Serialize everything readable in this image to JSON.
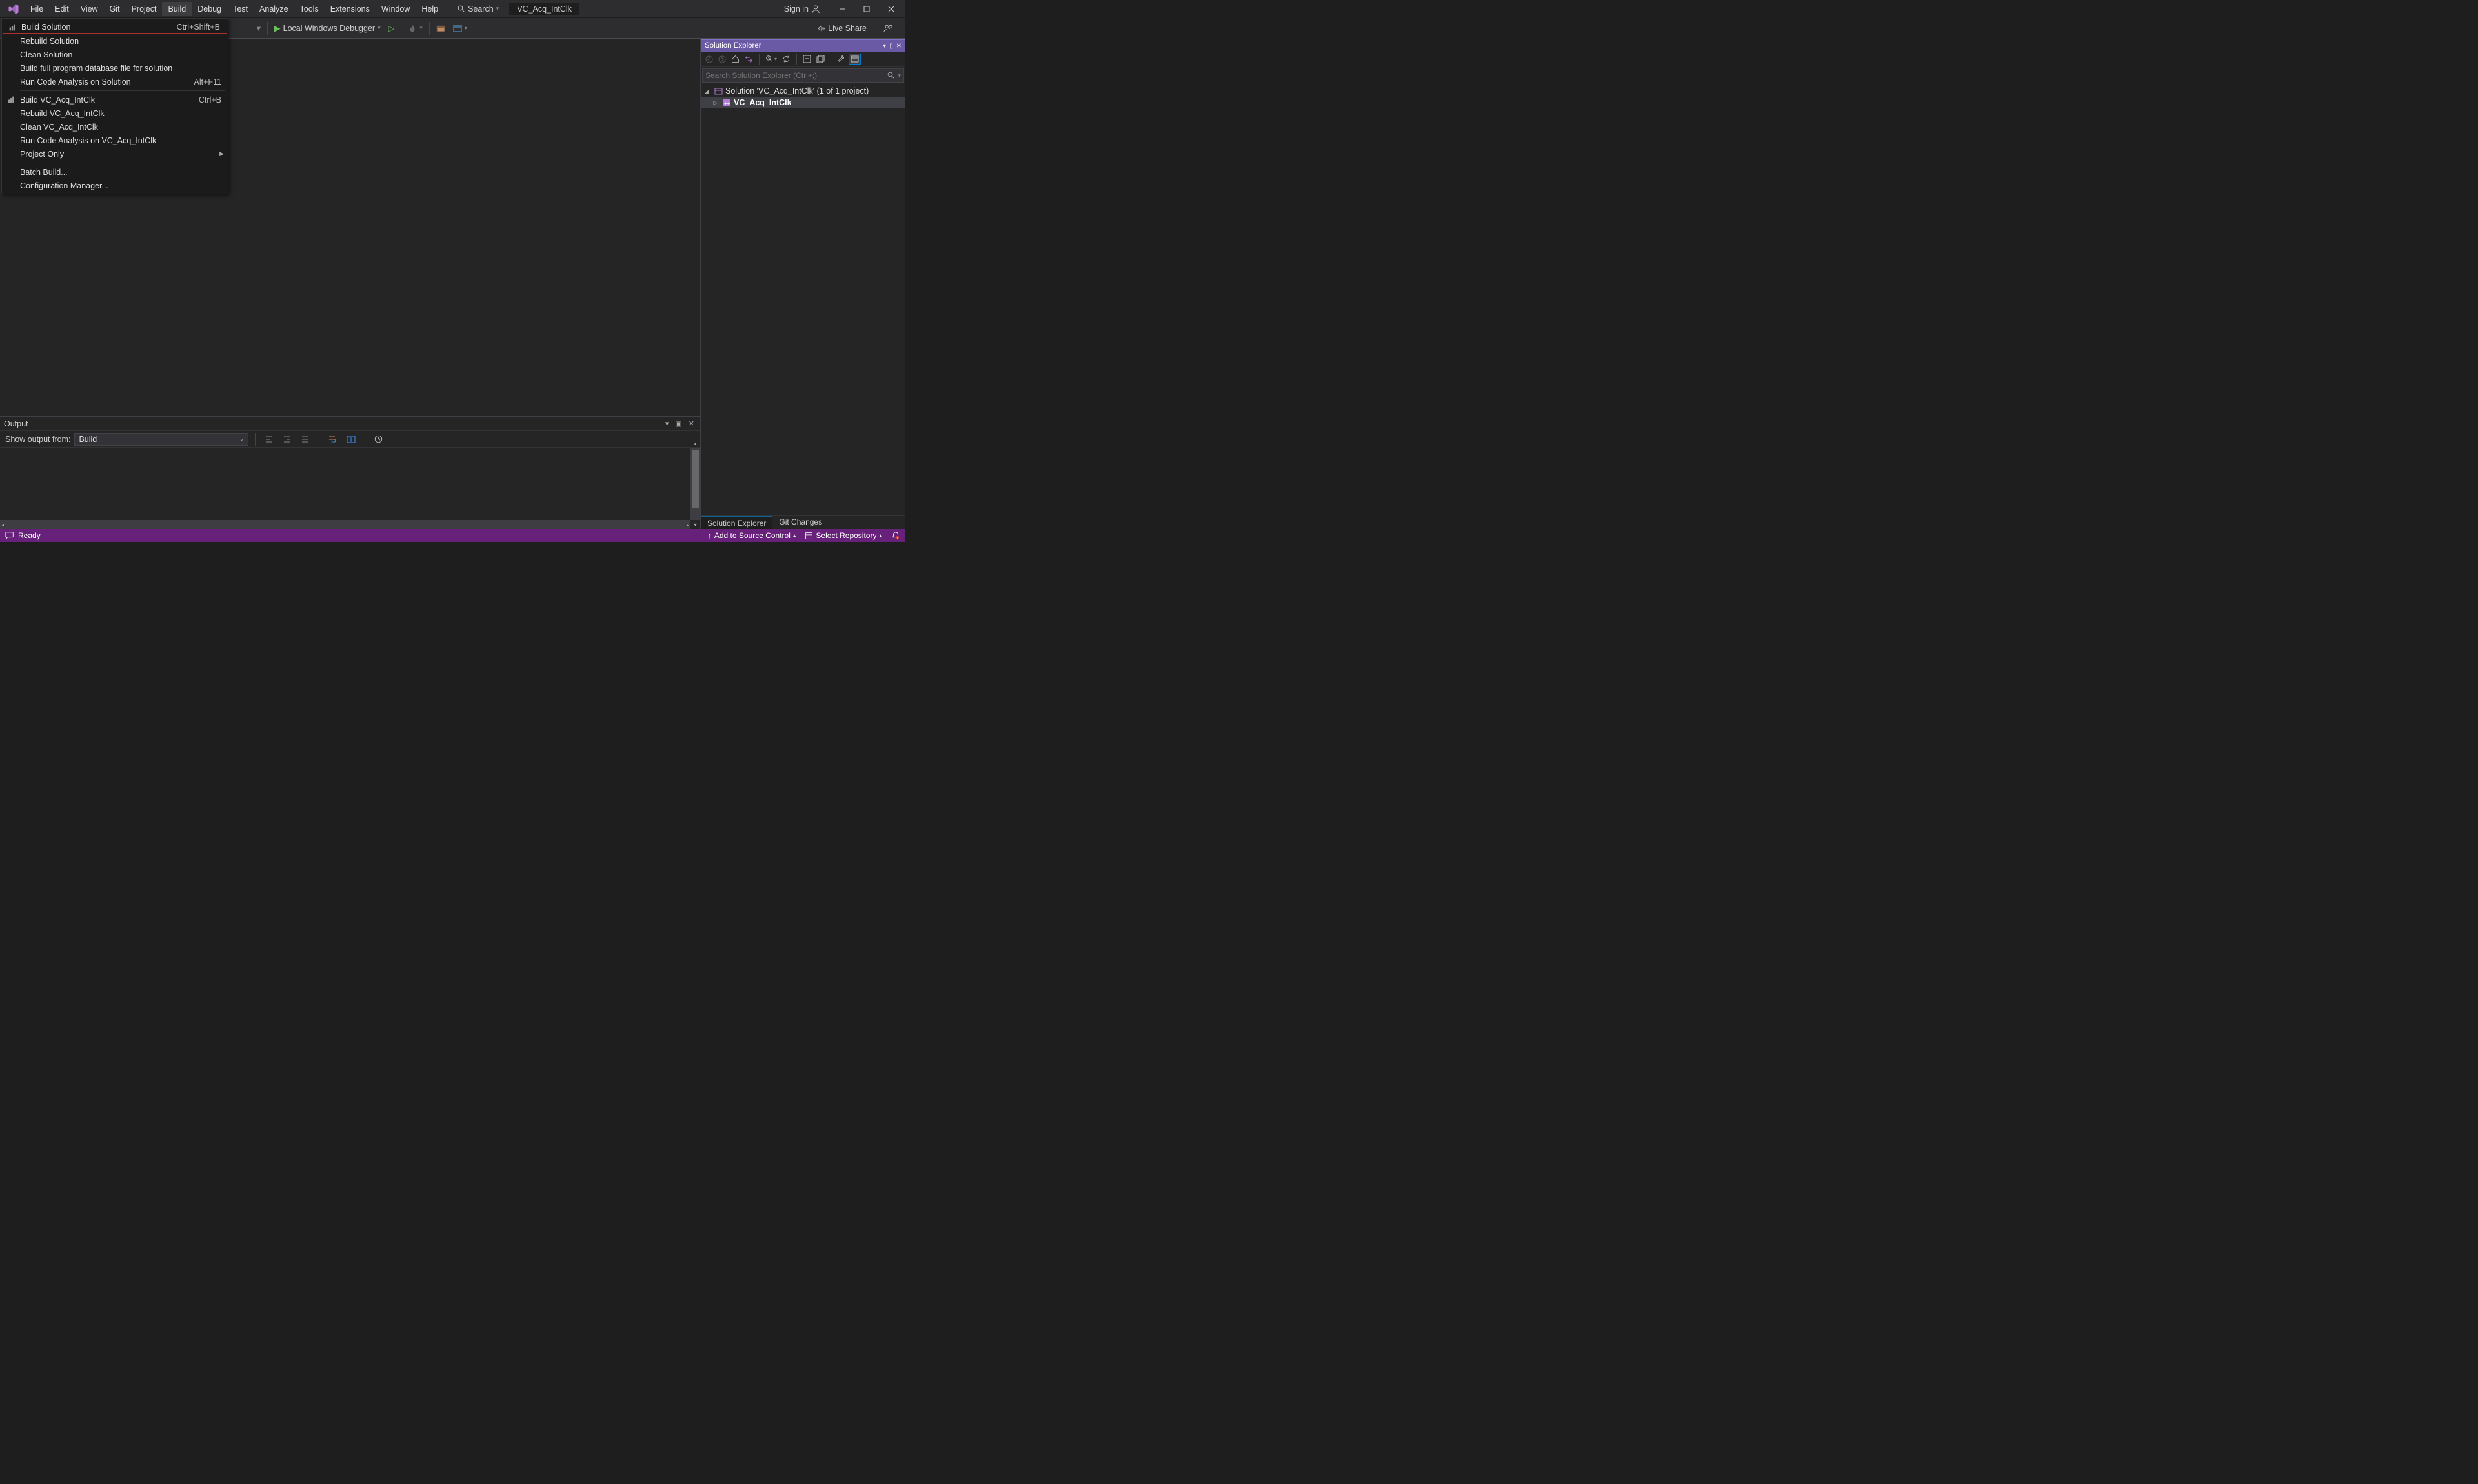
{
  "menu": {
    "items": [
      "File",
      "Edit",
      "View",
      "Git",
      "Project",
      "Build",
      "Debug",
      "Test",
      "Analyze",
      "Tools",
      "Extensions",
      "Window",
      "Help"
    ],
    "active_index": 5,
    "search_label": "Search",
    "project_title": "VC_Acq_IntClk",
    "signin": "Sign in"
  },
  "toolbar": {
    "debugger_label": "Local Windows Debugger",
    "liveshare": "Live Share"
  },
  "build_menu": {
    "items": [
      {
        "label": "Build Solution",
        "shortcut": "Ctrl+Shift+B",
        "icon": "build",
        "highlighted": true
      },
      {
        "label": "Rebuild Solution",
        "shortcut": ""
      },
      {
        "label": "Clean Solution",
        "shortcut": ""
      },
      {
        "label": "Build full program database file for solution",
        "shortcut": ""
      },
      {
        "label": "Run Code Analysis on Solution",
        "shortcut": "Alt+F11"
      },
      {
        "sep": true
      },
      {
        "label": "Build VC_Acq_IntClk",
        "shortcut": "Ctrl+B",
        "icon": "build-proj"
      },
      {
        "label": "Rebuild VC_Acq_IntClk",
        "shortcut": ""
      },
      {
        "label": "Clean VC_Acq_IntClk",
        "shortcut": ""
      },
      {
        "label": "Run Code Analysis on VC_Acq_IntClk",
        "shortcut": ""
      },
      {
        "label": "Project Only",
        "shortcut": "",
        "submenu": true
      },
      {
        "sep": true
      },
      {
        "label": "Batch Build...",
        "shortcut": ""
      },
      {
        "label": "Configuration Manager...",
        "shortcut": ""
      }
    ]
  },
  "output": {
    "title": "Output",
    "show_from_label": "Show output from:",
    "source": "Build"
  },
  "solution_explorer": {
    "title": "Solution Explorer",
    "search_placeholder": "Search Solution Explorer (Ctrl+;)",
    "solution_label": "Solution 'VC_Acq_IntClk' (1 of 1 project)",
    "project_label": "VC_Acq_IntClk",
    "tabs": [
      "Solution Explorer",
      "Git Changes"
    ],
    "active_tab": 0
  },
  "statusbar": {
    "ready": "Ready",
    "add_source_control": "Add to Source Control",
    "select_repo": "Select Repository"
  }
}
